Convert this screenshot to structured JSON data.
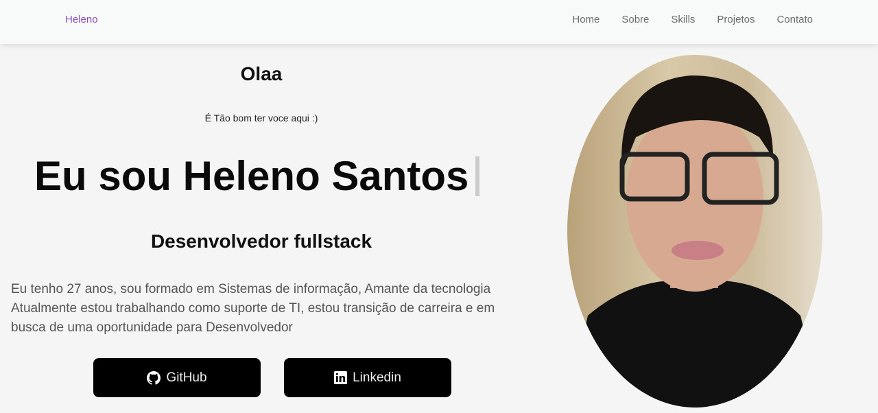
{
  "nav": {
    "brand": "Heleno",
    "links": [
      "Home",
      "Sobre",
      "Skills",
      "Projetos",
      "Contato"
    ]
  },
  "hero": {
    "greeting": "Olaa",
    "subtitle": "É Tão bom ter voce aqui :)",
    "name": "Eu sou Heleno Santos",
    "role": "Desenvolvedor fullstack",
    "bio": "Eu tenho 27 anos, sou formado em Sistemas de informação, Amante da tecnologia Atualmente estou trabalhando como suporte de TI, estou transição de carreira e em busca de uma oportunidade para Desenvolvedor"
  },
  "buttons": {
    "github": "GitHub",
    "linkedin": "Linkedin"
  }
}
